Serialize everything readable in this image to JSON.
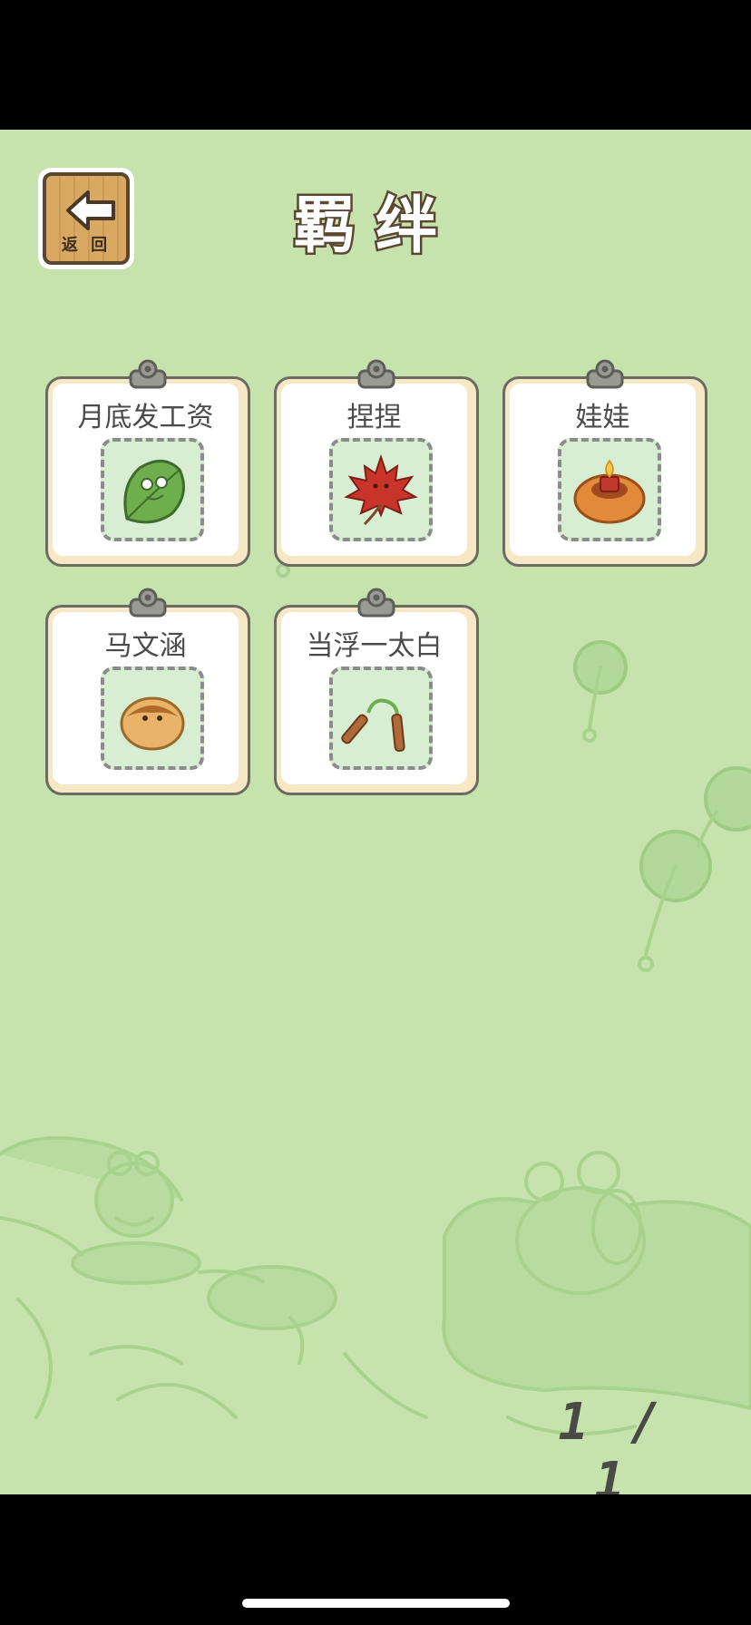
{
  "header": {
    "title": "羁绊",
    "back_label": "返 回"
  },
  "items": [
    {
      "label": "月底发工资",
      "icon": "leaf-frog-icon"
    },
    {
      "label": "捏捏",
      "icon": "maple-leaf-icon"
    },
    {
      "label": "娃娃",
      "icon": "candle-bread-icon"
    },
    {
      "label": "马文涵",
      "icon": "bread-bun-icon"
    },
    {
      "label": "当浮一太白",
      "icon": "nunchaku-icon"
    }
  ],
  "pagination": {
    "text": "1 / 1",
    "current": 1,
    "total": 1
  },
  "colors": {
    "background": "#c6e3ae",
    "card_frame": "#f6e8c4",
    "photo_bg": "#d8eed2",
    "button_wood": "#d9a964",
    "outline": "#5b4630"
  }
}
